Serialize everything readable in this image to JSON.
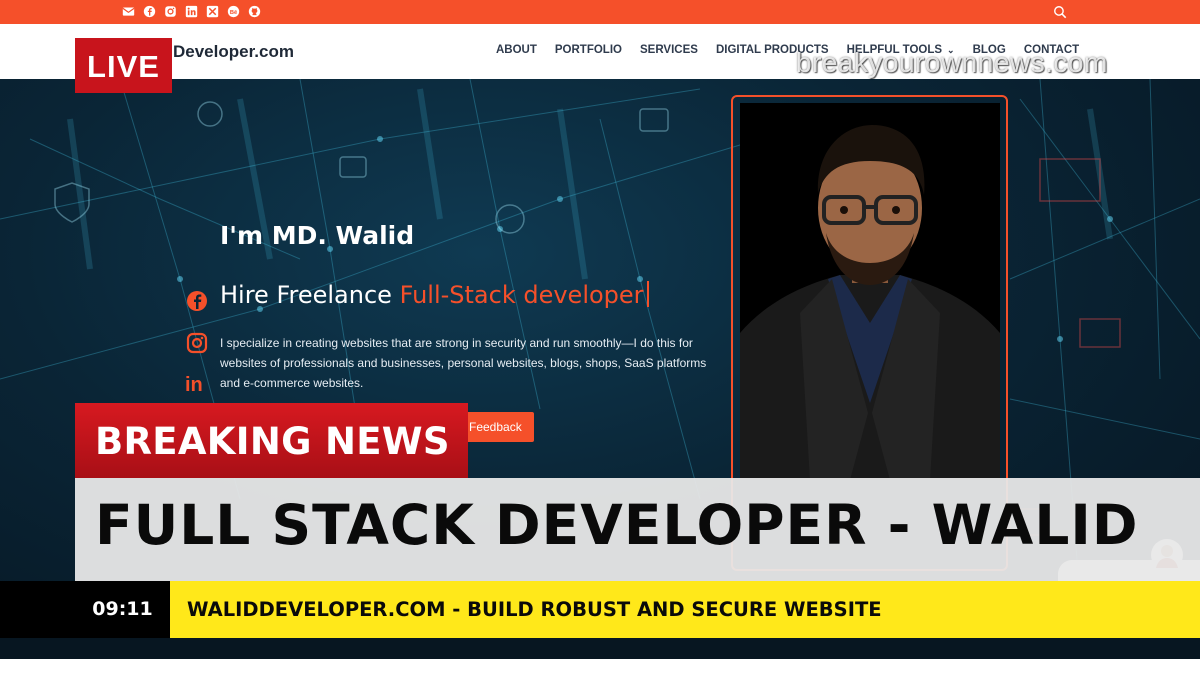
{
  "topbar": {
    "social_icons": [
      "email-icon",
      "facebook-icon",
      "instagram-icon",
      "linkedin-icon",
      "x-icon",
      "behance-icon",
      "github-icon"
    ],
    "search_icon": "search-icon",
    "color": "#f5502a"
  },
  "header": {
    "brand": "Developer.com",
    "nav": [
      {
        "label": "ABOUT"
      },
      {
        "label": "PORTFOLIO"
      },
      {
        "label": "SERVICES"
      },
      {
        "label": "DIGITAL PRODUCTS"
      },
      {
        "label": "HELPFUL TOOLS",
        "has_dropdown": true
      },
      {
        "label": "BLOG"
      },
      {
        "label": "CONTACT"
      }
    ]
  },
  "watermark": "breakyourownnews.com",
  "live_badge": "LIVE",
  "hero": {
    "side_icons": [
      "facebook-icon",
      "instagram-icon",
      "linkedin-icon",
      "x-icon",
      "behance-icon"
    ],
    "greeting": "I'm MD. Walid",
    "role_prefix": "Hire Freelance",
    "role_accent": "Full-Stack developer",
    "description": "I specialize in creating websites that are strong in security and run smoothly—I do this for websites of professionals and businesses, personal websites, blogs, shops, SaaS platforms and e-commerce websites.",
    "feedback_button": "Feedback",
    "accent_color": "#f5502a"
  },
  "news": {
    "breaking_label": "BREAKING NEWS",
    "headline": "FULL STACK DEVELOPER - WALID",
    "time": "09:11",
    "ticker": "WALIDDEVELOPER.COM - BUILD ROBUST AND SECURE WEBSITE",
    "breaking_color": "#d71920",
    "ticker_color": "#ffe81a"
  }
}
